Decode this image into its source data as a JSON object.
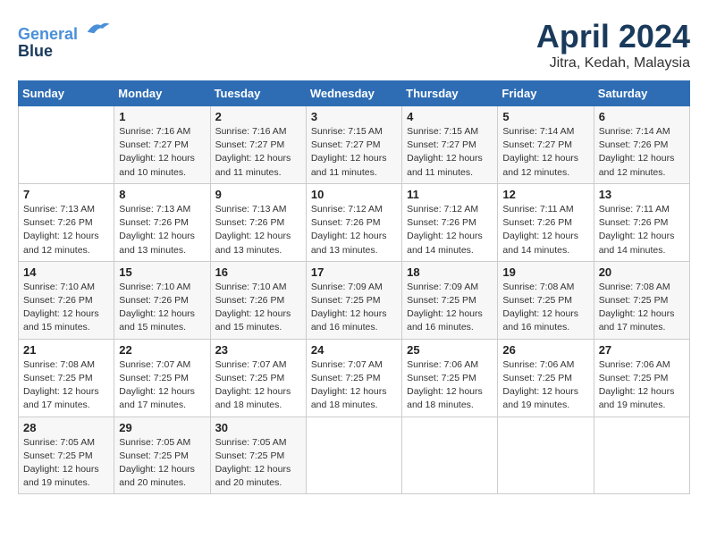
{
  "logo": {
    "line1": "General",
    "line2": "Blue"
  },
  "title": "April 2024",
  "subtitle": "Jitra, Kedah, Malaysia",
  "days_of_week": [
    "Sunday",
    "Monday",
    "Tuesday",
    "Wednesday",
    "Thursday",
    "Friday",
    "Saturday"
  ],
  "weeks": [
    [
      {
        "day": "",
        "info": ""
      },
      {
        "day": "1",
        "info": "Sunrise: 7:16 AM\nSunset: 7:27 PM\nDaylight: 12 hours\nand 10 minutes."
      },
      {
        "day": "2",
        "info": "Sunrise: 7:16 AM\nSunset: 7:27 PM\nDaylight: 12 hours\nand 11 minutes."
      },
      {
        "day": "3",
        "info": "Sunrise: 7:15 AM\nSunset: 7:27 PM\nDaylight: 12 hours\nand 11 minutes."
      },
      {
        "day": "4",
        "info": "Sunrise: 7:15 AM\nSunset: 7:27 PM\nDaylight: 12 hours\nand 11 minutes."
      },
      {
        "day": "5",
        "info": "Sunrise: 7:14 AM\nSunset: 7:27 PM\nDaylight: 12 hours\nand 12 minutes."
      },
      {
        "day": "6",
        "info": "Sunrise: 7:14 AM\nSunset: 7:26 PM\nDaylight: 12 hours\nand 12 minutes."
      }
    ],
    [
      {
        "day": "7",
        "info": "Sunrise: 7:13 AM\nSunset: 7:26 PM\nDaylight: 12 hours\nand 12 minutes."
      },
      {
        "day": "8",
        "info": "Sunrise: 7:13 AM\nSunset: 7:26 PM\nDaylight: 12 hours\nand 13 minutes."
      },
      {
        "day": "9",
        "info": "Sunrise: 7:13 AM\nSunset: 7:26 PM\nDaylight: 12 hours\nand 13 minutes."
      },
      {
        "day": "10",
        "info": "Sunrise: 7:12 AM\nSunset: 7:26 PM\nDaylight: 12 hours\nand 13 minutes."
      },
      {
        "day": "11",
        "info": "Sunrise: 7:12 AM\nSunset: 7:26 PM\nDaylight: 12 hours\nand 14 minutes."
      },
      {
        "day": "12",
        "info": "Sunrise: 7:11 AM\nSunset: 7:26 PM\nDaylight: 12 hours\nand 14 minutes."
      },
      {
        "day": "13",
        "info": "Sunrise: 7:11 AM\nSunset: 7:26 PM\nDaylight: 12 hours\nand 14 minutes."
      }
    ],
    [
      {
        "day": "14",
        "info": "Sunrise: 7:10 AM\nSunset: 7:26 PM\nDaylight: 12 hours\nand 15 minutes."
      },
      {
        "day": "15",
        "info": "Sunrise: 7:10 AM\nSunset: 7:26 PM\nDaylight: 12 hours\nand 15 minutes."
      },
      {
        "day": "16",
        "info": "Sunrise: 7:10 AM\nSunset: 7:26 PM\nDaylight: 12 hours\nand 15 minutes."
      },
      {
        "day": "17",
        "info": "Sunrise: 7:09 AM\nSunset: 7:25 PM\nDaylight: 12 hours\nand 16 minutes."
      },
      {
        "day": "18",
        "info": "Sunrise: 7:09 AM\nSunset: 7:25 PM\nDaylight: 12 hours\nand 16 minutes."
      },
      {
        "day": "19",
        "info": "Sunrise: 7:08 AM\nSunset: 7:25 PM\nDaylight: 12 hours\nand 16 minutes."
      },
      {
        "day": "20",
        "info": "Sunrise: 7:08 AM\nSunset: 7:25 PM\nDaylight: 12 hours\nand 17 minutes."
      }
    ],
    [
      {
        "day": "21",
        "info": "Sunrise: 7:08 AM\nSunset: 7:25 PM\nDaylight: 12 hours\nand 17 minutes."
      },
      {
        "day": "22",
        "info": "Sunrise: 7:07 AM\nSunset: 7:25 PM\nDaylight: 12 hours\nand 17 minutes."
      },
      {
        "day": "23",
        "info": "Sunrise: 7:07 AM\nSunset: 7:25 PM\nDaylight: 12 hours\nand 18 minutes."
      },
      {
        "day": "24",
        "info": "Sunrise: 7:07 AM\nSunset: 7:25 PM\nDaylight: 12 hours\nand 18 minutes."
      },
      {
        "day": "25",
        "info": "Sunrise: 7:06 AM\nSunset: 7:25 PM\nDaylight: 12 hours\nand 18 minutes."
      },
      {
        "day": "26",
        "info": "Sunrise: 7:06 AM\nSunset: 7:25 PM\nDaylight: 12 hours\nand 19 minutes."
      },
      {
        "day": "27",
        "info": "Sunrise: 7:06 AM\nSunset: 7:25 PM\nDaylight: 12 hours\nand 19 minutes."
      }
    ],
    [
      {
        "day": "28",
        "info": "Sunrise: 7:05 AM\nSunset: 7:25 PM\nDaylight: 12 hours\nand 19 minutes."
      },
      {
        "day": "29",
        "info": "Sunrise: 7:05 AM\nSunset: 7:25 PM\nDaylight: 12 hours\nand 20 minutes."
      },
      {
        "day": "30",
        "info": "Sunrise: 7:05 AM\nSunset: 7:25 PM\nDaylight: 12 hours\nand 20 minutes."
      },
      {
        "day": "",
        "info": ""
      },
      {
        "day": "",
        "info": ""
      },
      {
        "day": "",
        "info": ""
      },
      {
        "day": "",
        "info": ""
      }
    ]
  ]
}
